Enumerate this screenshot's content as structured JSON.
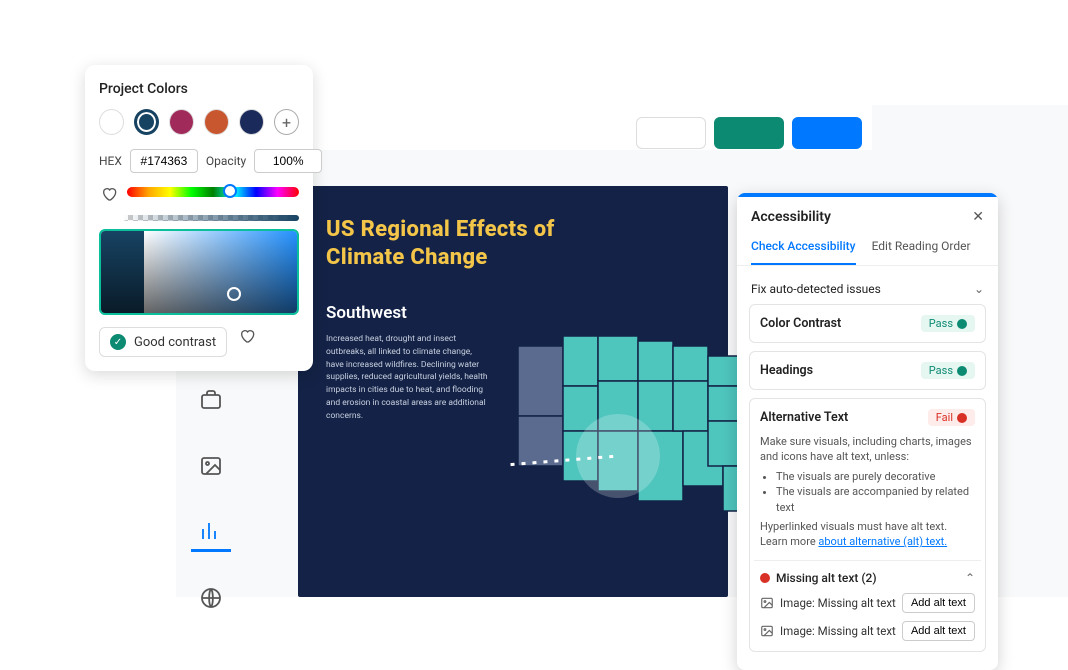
{
  "colorPanel": {
    "title": "Project Colors",
    "swatches": [
      "#ffffff",
      "#174363",
      "#a02a5a",
      "#c8562e",
      "#1a2a5a"
    ],
    "selectedIndex": 1,
    "hexLabel": "HEX",
    "hexValue": "#174363",
    "opacityLabel": "Opacity",
    "opacityValue": "100%",
    "contrastLabel": "Good contrast"
  },
  "canvas": {
    "title1": "US Regional Effects of",
    "title2": "Climate Change",
    "region": "Southwest",
    "body": "Increased heat, drought and insect outbreaks, all linked to climate change, have increased wildfires. Declining water supplies, reduced agricultural yields, health impacts in cities due to heat, and flooding and erosion in coastal areas are additional concerns."
  },
  "a11y": {
    "title": "Accessibility",
    "tabs": {
      "check": "Check Accessibility",
      "order": "Edit Reading Order"
    },
    "fixLabel": "Fix auto-detected issues",
    "checks": {
      "contrast": {
        "name": "Color Contrast",
        "status": "Pass"
      },
      "headings": {
        "name": "Headings",
        "status": "Pass"
      },
      "alt": {
        "name": "Alternative Text",
        "status": "Fail",
        "desc": "Make sure visuals, including charts, images and icons have alt text, unless:",
        "bullet1": "The visuals are purely decorative",
        "bullet2": "The visuals are accompanied by related text",
        "linked": "Hyperlinked visuals must have alt text.",
        "learnPrefix": "Learn more ",
        "learnLink": "about alternative (alt) text."
      }
    },
    "missing": {
      "header": "Missing alt text (2)",
      "item": "Image: Missing alt text",
      "button": "Add alt text"
    }
  }
}
